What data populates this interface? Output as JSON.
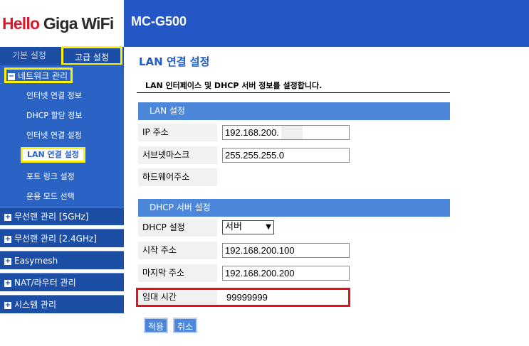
{
  "header": {
    "logo_hello": "Hello",
    "logo_giga": " Giga WiFi",
    "model": "MC-G500"
  },
  "sidebar": {
    "tab_basic": "기본 설정",
    "tab_advanced": "고급 설정",
    "network_menu": "네트워크 관리",
    "network_items": [
      {
        "label": "인터넷 연결 정보"
      },
      {
        "label": "DHCP 할당 정보"
      },
      {
        "label": "인터넷 연결 설정"
      },
      {
        "label": "LAN 연결 설정"
      },
      {
        "label": "포트 링크 설정"
      },
      {
        "label": "운용 모드 선택"
      }
    ],
    "groups": [
      {
        "label": "무선랜 관리 [5GHz]"
      },
      {
        "label": "무선랜 관리 [2.4GHz]"
      },
      {
        "label": "Easymesh"
      },
      {
        "label": "NAT/라우터 관리"
      },
      {
        "label": "시스템 관리"
      }
    ],
    "expanded_symbol": "−",
    "collapsed_symbol": "+"
  },
  "main": {
    "title": "LAN 연결 설정",
    "description": "LAN 인터페이스 및 DHCP 서버 정보를 설정합니다.",
    "lan_section": {
      "title": "LAN 설정",
      "ip_label": "IP 주소",
      "ip_value": "192.168.200.",
      "subnet_label": "서브넷마스크",
      "subnet_value": "255.255.255.0",
      "hw_label": "하드웨어주소",
      "hw_value": ""
    },
    "dhcp_section": {
      "title": "DHCP 서버 설정",
      "dhcp_label": "DHCP 설정",
      "dhcp_value": "서버",
      "start_label": "시작 주소",
      "start_value": "192.168.200.100",
      "end_label": "마지막 주소",
      "end_value": "192.168.200.200",
      "lease_label": "임대 시간",
      "lease_value": "99999999"
    },
    "apply_button": "적용",
    "cancel_button": "취소"
  },
  "colors": {
    "brand_blue": "#2456c6",
    "menu_blue": "#2a63c4",
    "section_blue": "#4d87dc",
    "highlight_yellow": "#fff200",
    "highlight_red": "#e0141e",
    "logo_red": "#d7192b"
  }
}
